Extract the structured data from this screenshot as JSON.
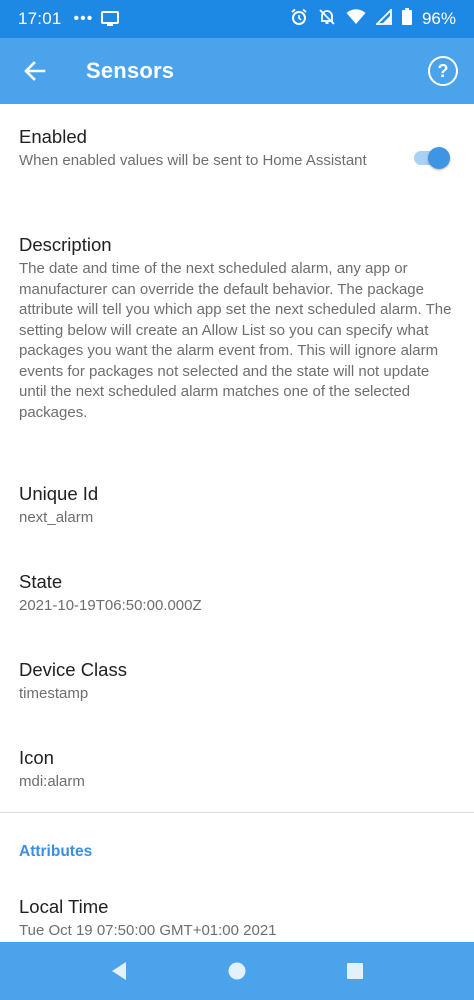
{
  "status_bar": {
    "time": "17:01",
    "battery_percent": "96%",
    "icons": [
      "notification-dots-icon",
      "cast-screen-icon",
      "alarm-icon",
      "mute-icon",
      "wifi-icon",
      "signal-icon",
      "battery-icon"
    ]
  },
  "app_bar": {
    "title": "Sensors",
    "help_label": "?"
  },
  "prefs": {
    "enabled": {
      "title": "Enabled",
      "summary": "When enabled values will be sent to Home Assistant",
      "toggle_on": true
    },
    "description": {
      "title": "Description",
      "summary": "The date and time of the next scheduled alarm, any app or manufacturer can override the default behavior. The package attribute will tell you which app set the next scheduled alarm. The setting below will create an Allow List so you can specify what packages you want the alarm event from. This will ignore alarm events for packages not selected and the state will not update until the next scheduled alarm matches one of the selected packages."
    },
    "unique_id": {
      "title": "Unique Id",
      "summary": "next_alarm"
    },
    "state": {
      "title": "State",
      "summary": "2021-10-19T06:50:00.000Z"
    },
    "device_class": {
      "title": "Device Class",
      "summary": "timestamp"
    },
    "icon": {
      "title": "Icon",
      "summary": "mdi:alarm"
    }
  },
  "attributes": {
    "category_title": "Attributes",
    "local_time": {
      "title": "Local Time",
      "summary": "Tue Oct 19 07:50:00 GMT+01:00 2021"
    }
  },
  "colors": {
    "status_bar": "#1e88e5",
    "app_bar": "#4ba3eb",
    "accent": "#3d95e4"
  }
}
